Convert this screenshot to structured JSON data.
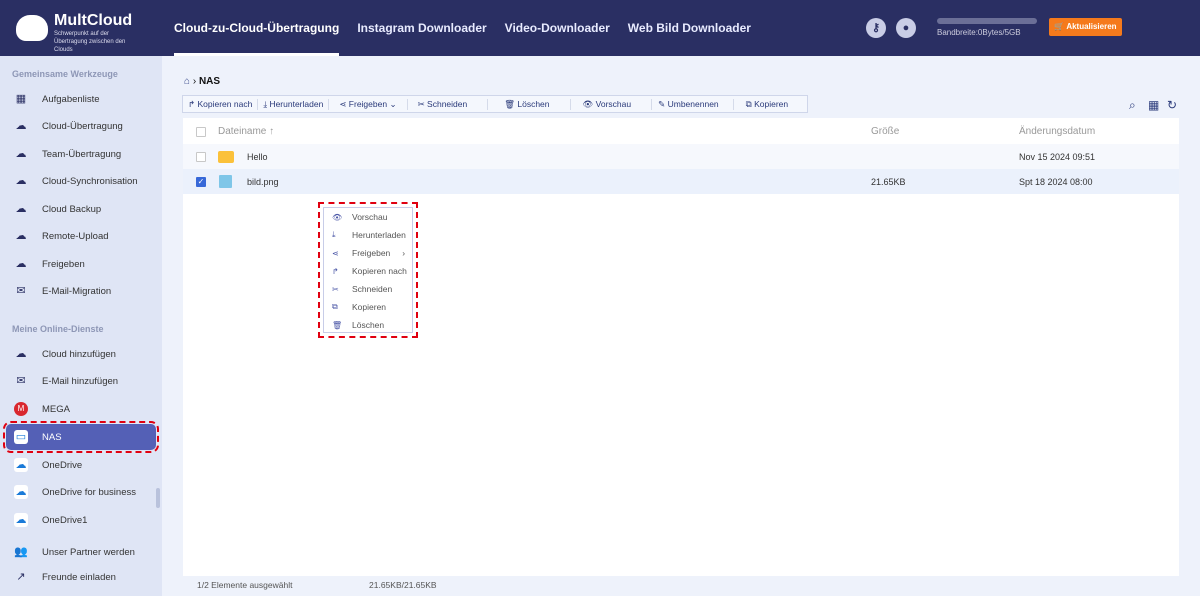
{
  "header": {
    "brand": "MultCloud",
    "tagline": "Schwerpunkt auf der Übertragung zwischen den Clouds",
    "nav": [
      "Cloud-zu-Cloud-Übertragung",
      "Instagram Downloader",
      "Video-Downloader",
      "Web Bild Downloader"
    ],
    "bandwidth": "Bandbreite:0Bytes/5GB",
    "upgrade": "Aktualisieren"
  },
  "sidebar": {
    "section1": "Gemeinsame Werkzeuge",
    "tools": [
      "Aufgabenliste",
      "Cloud-Übertragung",
      "Team-Übertragung",
      "Cloud-Synchronisation",
      "Cloud Backup",
      "Remote-Upload",
      "Freigeben",
      "E-Mail-Migration"
    ],
    "section2": "Meine Online-Dienste",
    "services": [
      "Cloud hinzufügen",
      "E-Mail hinzufügen",
      "MEGA",
      "NAS",
      "OneDrive",
      "OneDrive for business",
      "OneDrive1"
    ],
    "bottom": [
      "Unser Partner werden",
      "Freunde einladen"
    ]
  },
  "breadcrumb": "NAS",
  "toolbar": [
    "Kopieren nach",
    "Herunterladen",
    "Freigeben",
    "Schneiden",
    "Löschen",
    "Vorschau",
    "Umbenennen",
    "Kopieren"
  ],
  "table": {
    "headers": [
      "Dateiname",
      "Größe",
      "Änderungsdatum"
    ],
    "rows": [
      {
        "name": "Hello",
        "size": "",
        "date": "Nov 15 2024 09:51",
        "checked": false
      },
      {
        "name": "bild.png",
        "size": "21.65KB",
        "date": "Spt 18 2024 08:00",
        "checked": true
      }
    ]
  },
  "context_menu": [
    "Vorschau",
    "Herunterladen",
    "Freigeben",
    "Kopieren nach",
    "Schneiden",
    "Kopieren",
    "Löschen"
  ],
  "footer": {
    "selected": "1/2 Elemente ausgewählt",
    "size": "21.65KB/21.65KB"
  }
}
